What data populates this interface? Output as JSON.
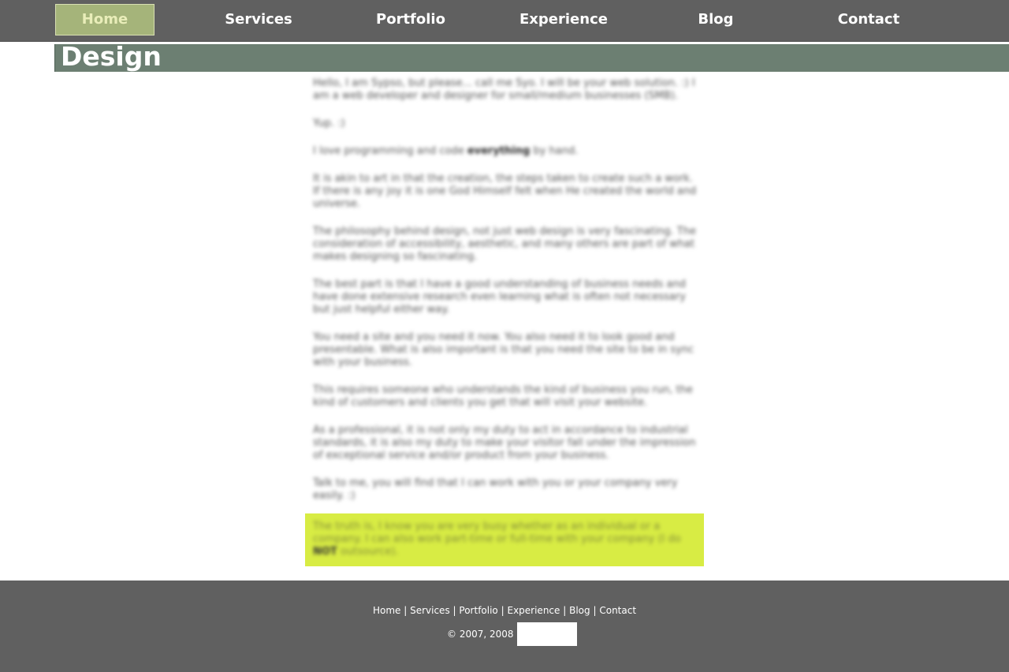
{
  "nav": {
    "items": [
      {
        "label": "Home",
        "active": true
      },
      {
        "label": "Services",
        "active": false
      },
      {
        "label": "Portfolio",
        "active": false
      },
      {
        "label": "Experience",
        "active": false
      },
      {
        "label": "Blog",
        "active": false
      },
      {
        "label": "Contact",
        "active": false
      }
    ]
  },
  "page": {
    "title": "Design"
  },
  "content": {
    "paragraphs": [
      "Hello, I am Sypso, but please... call me Syo. I will be your web solution. :) I am a web developer and designer for small/medium businesses (SMB).",
      "Yup. :)",
      "I love programming and code",
      "It is akin to art in that the creation, the steps taken to create such a work. If there is any joy it is one God Himself felt when He created the world and universe.",
      "The philosophy behind design, not just web design is very fascinating. The consideration of accessibility, aesthetic, and many others are part of what makes designing so fascinating.",
      "The best part is that I have a good understanding of business needs and have done extensive research even learning what is often not necessary but just helpful either way.",
      "You need a site and you need it now. You also need it to look good and presentable. What is also important is that you need the site to be in sync with your business.",
      "This requires someone who understands the kind of business you run, the kind of customers and clients you get that will visit your website.",
      "As a professional, it is not only my duty to act in accordance to industrial standards, it is also my duty to make your visitor fall under the impression of exceptional service and/or product from your business.",
      "Talk to me, you will find that I can work with you or your company very easily. :)"
    ],
    "code_emphasis": "everything",
    "code_tail": "by hand.",
    "highlight_text": "The truth is, I know you are very busy whether as an individual or a company. I can also work part-time or full-time with your company (I do",
    "highlight_emphasis": "NOT",
    "highlight_tail": "outsource)."
  },
  "footer": {
    "links": [
      "Home",
      "Services",
      "Portfolio",
      "Experience",
      "Blog",
      "Contact"
    ],
    "separator": "|",
    "copyright": "© 2007, 2008"
  },
  "colors": {
    "nav_bg": "#606060",
    "nav_active_bg": "#a5b47a",
    "title_bar_bg": "#6c7f72",
    "highlight_bg": "#d8ec44",
    "footer_bg": "#606060"
  }
}
